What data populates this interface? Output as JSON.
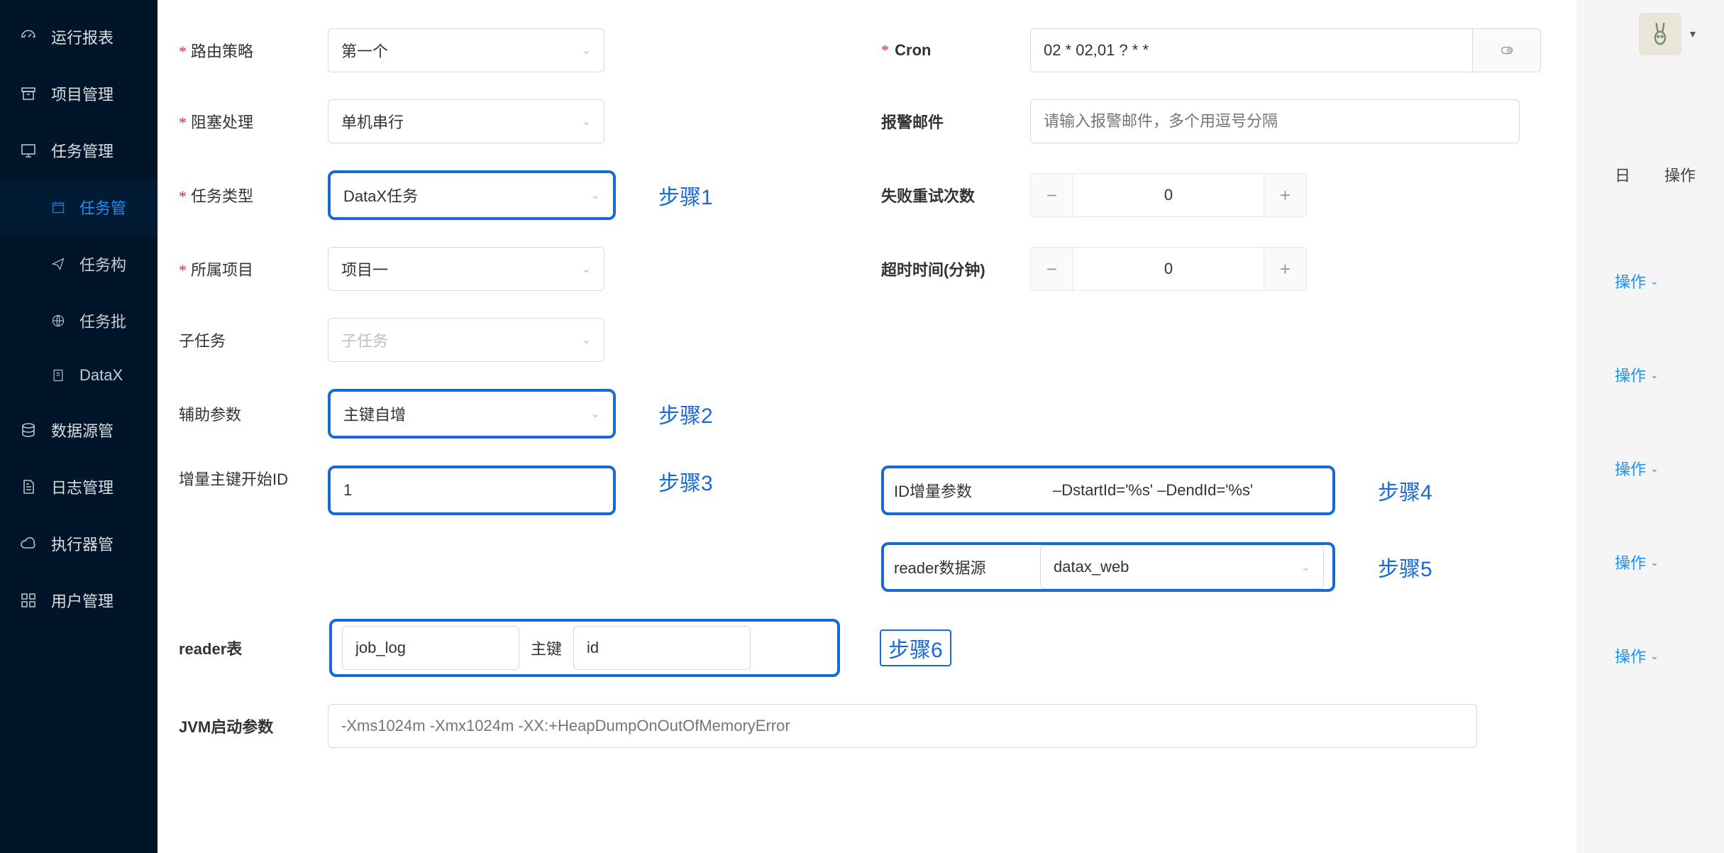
{
  "sidebar": {
    "items": [
      {
        "label": "运行报表",
        "icon": "dashboard"
      },
      {
        "label": "项目管理",
        "icon": "archive"
      },
      {
        "label": "任务管理",
        "icon": "monitor",
        "children": [
          {
            "label": "任务管",
            "active": true
          },
          {
            "label": "任务构"
          },
          {
            "label": "任务批"
          },
          {
            "label": "DataX"
          }
        ]
      },
      {
        "label": "数据源管",
        "icon": "database"
      },
      {
        "label": "日志管理",
        "icon": "file"
      },
      {
        "label": "执行器管",
        "icon": "cloud"
      },
      {
        "label": "用户管理",
        "icon": "grid"
      }
    ]
  },
  "bgtable": {
    "header_time_icon": "日",
    "header_action": "操作",
    "row_action": "操作"
  },
  "form": {
    "routing": {
      "label": "路由策略",
      "value": "第一个",
      "required": true
    },
    "cron": {
      "label": "Cron",
      "value": "02 * 02,01 ? * *",
      "required": true
    },
    "block": {
      "label": "阻塞处理",
      "value": "单机串行",
      "required": true
    },
    "alarm": {
      "label": "报警邮件",
      "placeholder": "请输入报警邮件，多个用逗号分隔"
    },
    "taskType": {
      "label": "任务类型",
      "value": "DataX任务",
      "required": true,
      "step": "步骤1"
    },
    "retry": {
      "label": "失败重试次数",
      "value": "0"
    },
    "project": {
      "label": "所属项目",
      "value": "项目一",
      "required": true
    },
    "timeout": {
      "label": "超时时间(分钟)",
      "value": "0"
    },
    "subtask": {
      "label": "子任务",
      "placeholder": "子任务"
    },
    "auxParam": {
      "label": "辅助参数",
      "value": "主键自增",
      "step": "步骤2"
    },
    "incStartId": {
      "label": "增量主键开始ID",
      "value": "1",
      "step": "步骤3"
    },
    "idIncParam": {
      "label": "ID增量参数",
      "value": "–DstartId='%s' –DendId='%s'",
      "step": "步骤4"
    },
    "readerDs": {
      "label": "reader数据源",
      "value": "datax_web",
      "step": "步骤5"
    },
    "readerTable": {
      "label": "reader表",
      "table": "job_log",
      "pk_label": "主键",
      "pk": "id",
      "step": "步骤6"
    },
    "jvm": {
      "label": "JVM启动参数",
      "placeholder": "-Xms1024m -Xmx1024m -XX:+HeapDumpOnOutOfMemoryError"
    }
  },
  "topbar": {
    "dropdown": "▾"
  }
}
